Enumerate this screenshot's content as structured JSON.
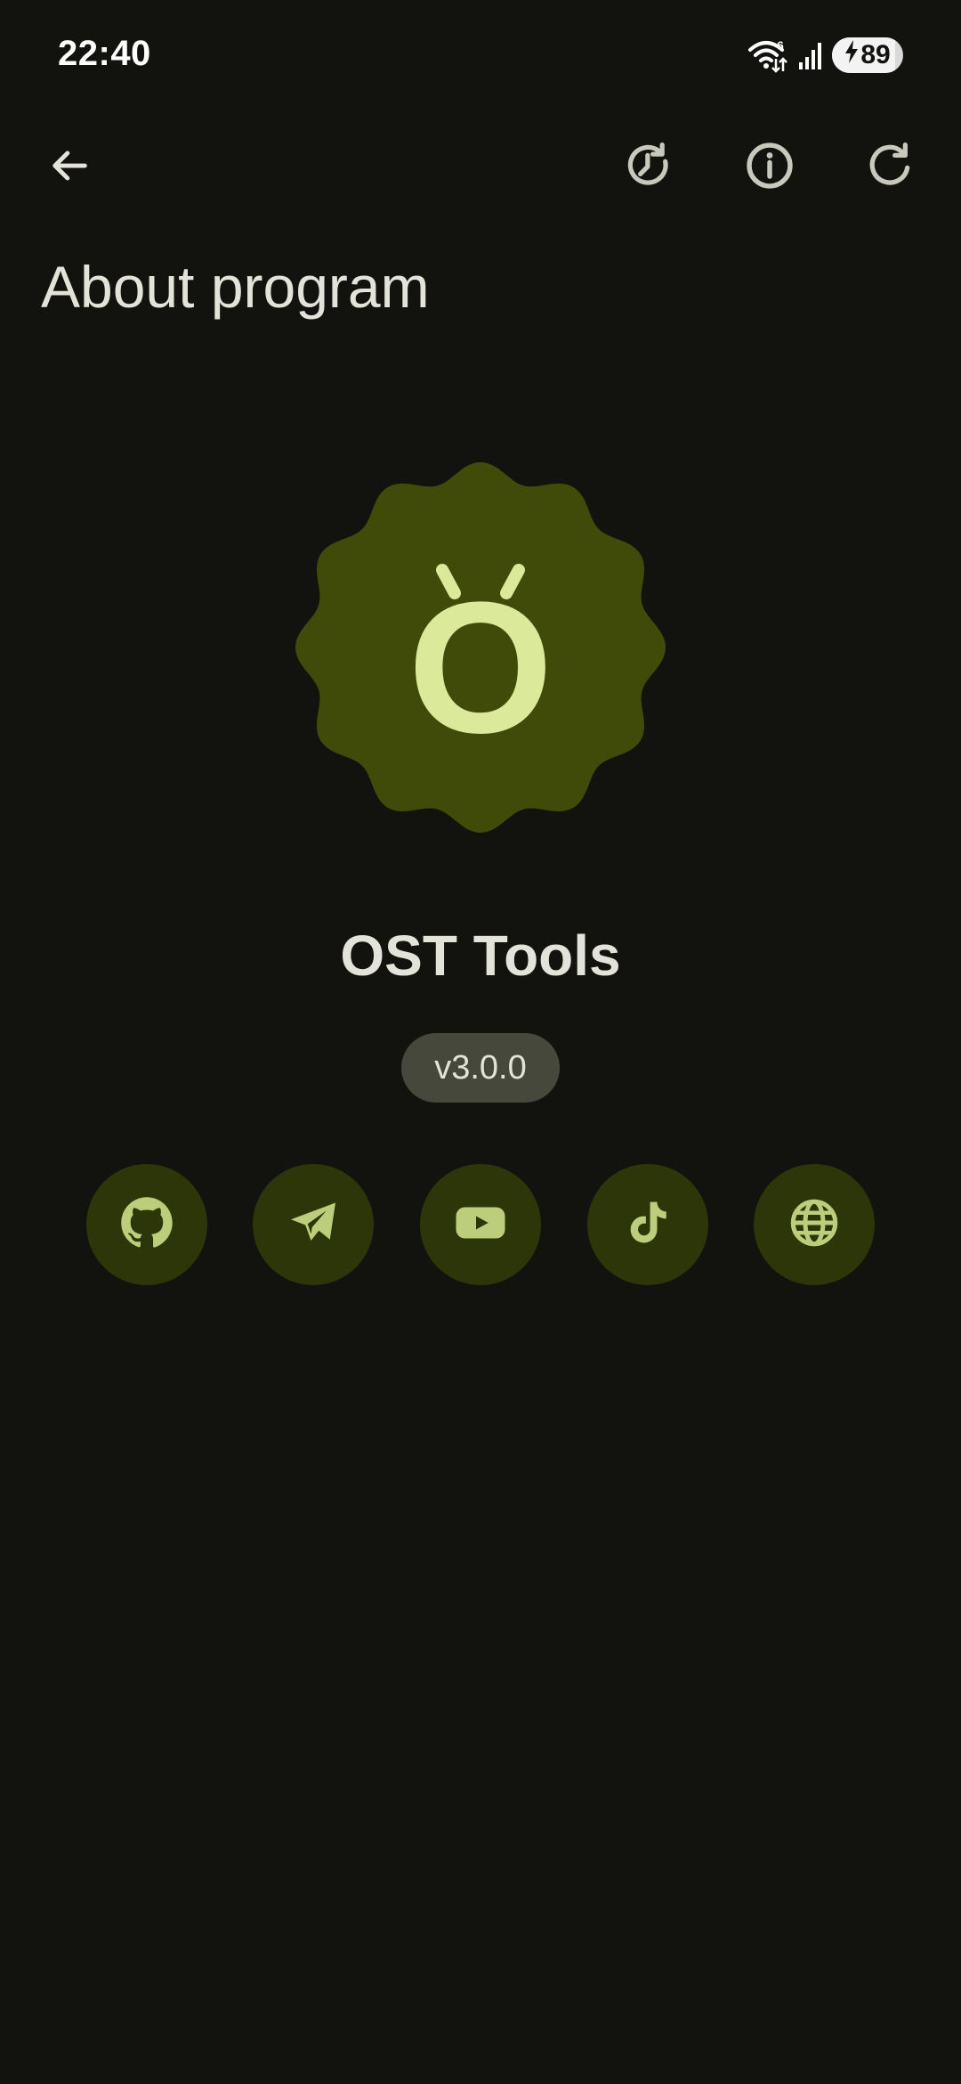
{
  "status_bar": {
    "time": "22:40",
    "network_badge": "6",
    "battery_level": "89",
    "battery_fraction": 0.89,
    "wifi_icon": "wifi-icon",
    "signal_icon": "cellular-signal-icon",
    "charging_icon": "bolt-icon"
  },
  "app_bar": {
    "back_icon": "arrow-back-icon",
    "history_icon": "history-icon",
    "info_icon": "info-icon",
    "refresh_icon": "refresh-icon"
  },
  "page": {
    "title": "About program"
  },
  "app": {
    "logo_letter": "O",
    "name": "OST Tools",
    "version": "v3.0.0"
  },
  "social_links": [
    {
      "name": "github",
      "icon": "github-icon"
    },
    {
      "name": "telegram",
      "icon": "telegram-icon"
    },
    {
      "name": "youtube",
      "icon": "youtube-icon"
    },
    {
      "name": "tiktok",
      "icon": "tiktok-icon"
    },
    {
      "name": "website",
      "icon": "globe-icon"
    }
  ],
  "colors": {
    "background": "#12130f",
    "on_surface": "#e4e3d9",
    "logo_background": "#404b0a",
    "logo_foreground": "#dbe99b",
    "chip_background": "#45483a",
    "social_background": "#2d3608",
    "social_icon": "#bcce7c"
  }
}
